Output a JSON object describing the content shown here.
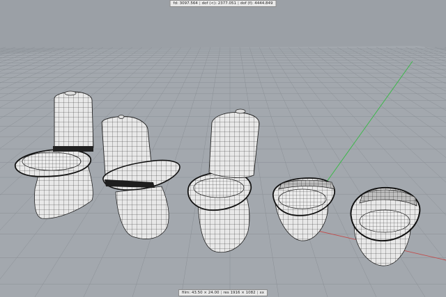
{
  "viewport": {
    "top_status": {
      "fd": "fd: 3097.564",
      "dof_near": "dof (<): 2377.051",
      "dof_far": "dof (f): 4444.849"
    },
    "bottom_status": {
      "film": "film: 43.50 × 24.00",
      "res": "res 1916 × 1082",
      "zoom": "xx"
    },
    "colors": {
      "background": "#9ba0a6",
      "grid_line": "#8a8f95",
      "ground": "#a3a8ae",
      "mesh_fill": "#e6e6e6",
      "mesh_wire": "#2a2a2a",
      "axis_y": "#3cb84a",
      "axis_x": "#c24a4a"
    },
    "objects": [
      {
        "name": "close-coupled-toilet-1"
      },
      {
        "name": "close-coupled-toilet-2"
      },
      {
        "name": "close-coupled-toilet-3"
      },
      {
        "name": "wall-hung-toilet-1"
      },
      {
        "name": "wall-hung-toilet-2"
      }
    ]
  }
}
